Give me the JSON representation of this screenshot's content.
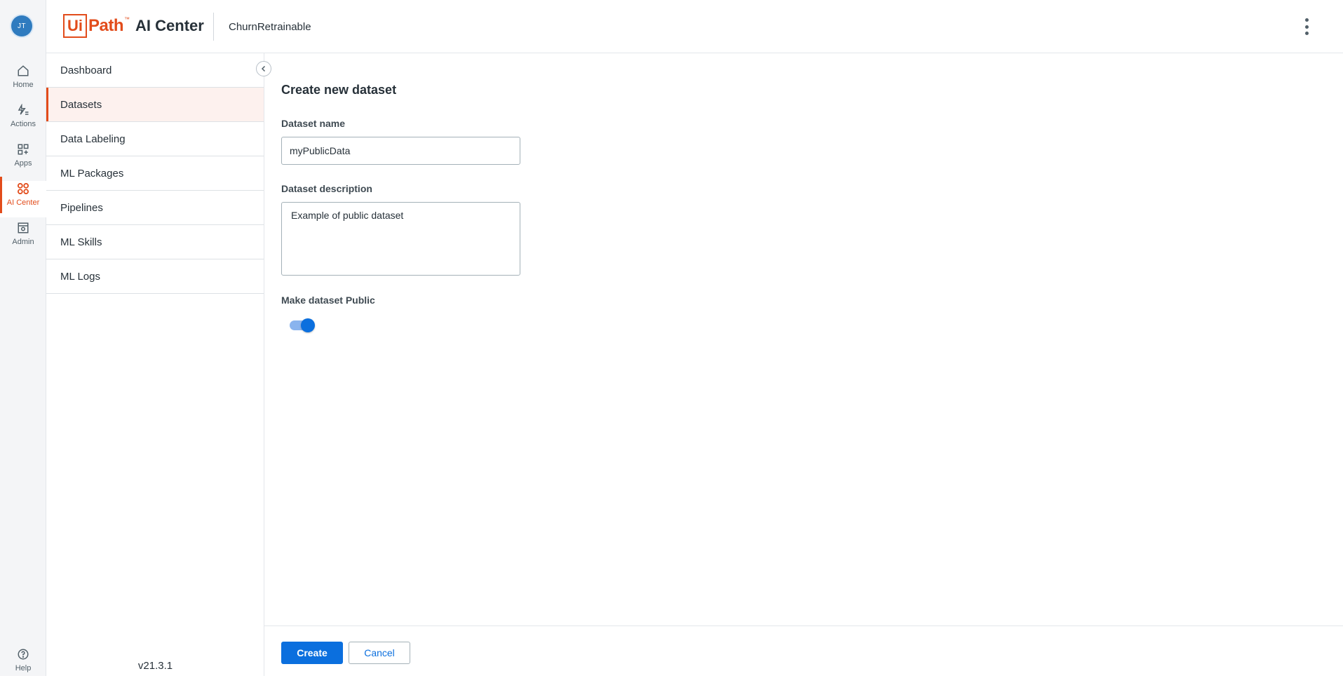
{
  "user": {
    "initials": "JT"
  },
  "rail": {
    "items": [
      {
        "label": "Home",
        "icon": "home-icon"
      },
      {
        "label": "Actions",
        "icon": "actions-icon"
      },
      {
        "label": "Apps",
        "icon": "apps-icon"
      },
      {
        "label": "AI Center",
        "icon": "ai-center-icon",
        "active": true
      },
      {
        "label": "Admin",
        "icon": "admin-icon"
      }
    ],
    "help_label": "Help"
  },
  "header": {
    "logo_ui": "Ui",
    "logo_path": "Path",
    "logo_tm": "™",
    "product": "AI Center",
    "project_name": "ChurnRetrainable"
  },
  "subnav": {
    "items": [
      {
        "label": "Dashboard"
      },
      {
        "label": "Datasets",
        "active": true
      },
      {
        "label": "Data Labeling"
      },
      {
        "label": "ML Packages"
      },
      {
        "label": "Pipelines"
      },
      {
        "label": "ML Skills"
      },
      {
        "label": "ML Logs"
      }
    ],
    "version": "v21.3.1"
  },
  "form": {
    "title": "Create new dataset",
    "name_label": "Dataset name",
    "name_value": "myPublicData",
    "description_label": "Dataset description",
    "description_value": "Example of public dataset",
    "public_label": "Make dataset Public",
    "public_enabled": true
  },
  "footer": {
    "create_label": "Create",
    "cancel_label": "Cancel"
  },
  "colors": {
    "brand": "#e24c1b",
    "primary": "#0b6fde",
    "active_bg": "#fdf1ee"
  }
}
